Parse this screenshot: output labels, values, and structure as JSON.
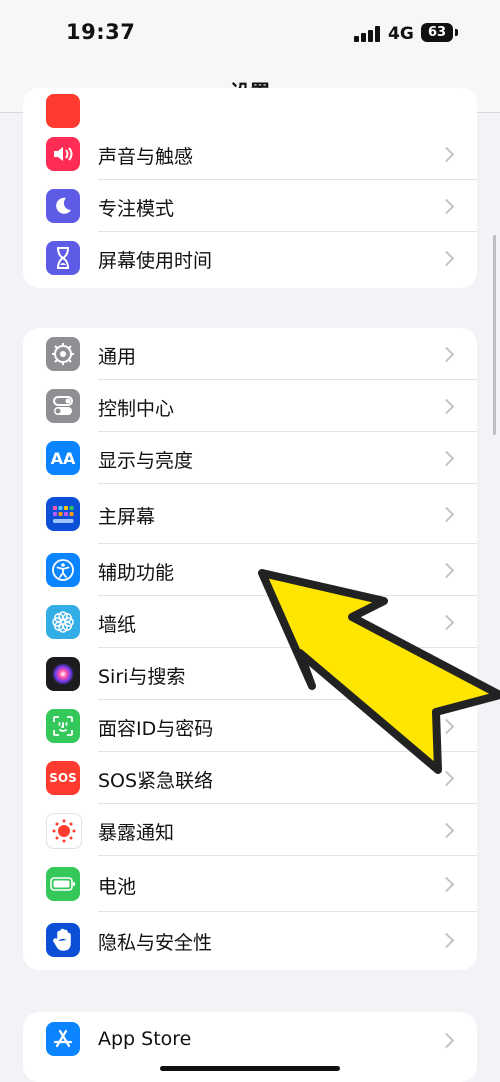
{
  "status": {
    "time": "19:37",
    "network": "4G",
    "battery": "63"
  },
  "nav": {
    "title": "设置"
  },
  "group1": [
    {
      "label": "声音与触感",
      "icon": "speaker-icon",
      "color": "#ff2d55"
    },
    {
      "label": "专注模式",
      "icon": "moon-icon",
      "color": "#5e5ce6"
    },
    {
      "label": "屏幕使用时间",
      "icon": "hourglass-icon",
      "color": "#5e5ce6"
    }
  ],
  "group2": [
    {
      "label": "通用",
      "icon": "gear-icon",
      "color": "#8e8e93"
    },
    {
      "label": "控制中心",
      "icon": "toggles-icon",
      "color": "#8e8e93"
    },
    {
      "label": "显示与亮度",
      "icon": "text-size-icon",
      "color": "#0a84ff"
    },
    {
      "label": "主屏幕",
      "icon": "home-grid-icon",
      "color": "#0a4fd6"
    },
    {
      "label": "辅助功能",
      "icon": "accessibility-icon",
      "color": "#0a84ff"
    },
    {
      "label": "墙纸",
      "icon": "flower-icon",
      "color": "#32ade6"
    },
    {
      "label": "Siri与搜索",
      "icon": "siri-icon",
      "color": "#1c1c1e"
    },
    {
      "label": "面容ID与密码",
      "icon": "face-id-icon",
      "color": "#34c759"
    },
    {
      "label": "SOS紧急联络",
      "icon": "sos-icon",
      "color": "#ff3b30"
    },
    {
      "label": "暴露通知",
      "icon": "exposure-icon",
      "color": "#ffffff"
    },
    {
      "label": "电池",
      "icon": "battery-icon",
      "color": "#34c759"
    },
    {
      "label": "隐私与安全性",
      "icon": "hand-icon",
      "color": "#0a4fd6"
    }
  ],
  "group3": [
    {
      "label": "App Store",
      "icon": "app-store-icon",
      "color": "#0a84ff"
    }
  ],
  "sos_text": "SOS"
}
